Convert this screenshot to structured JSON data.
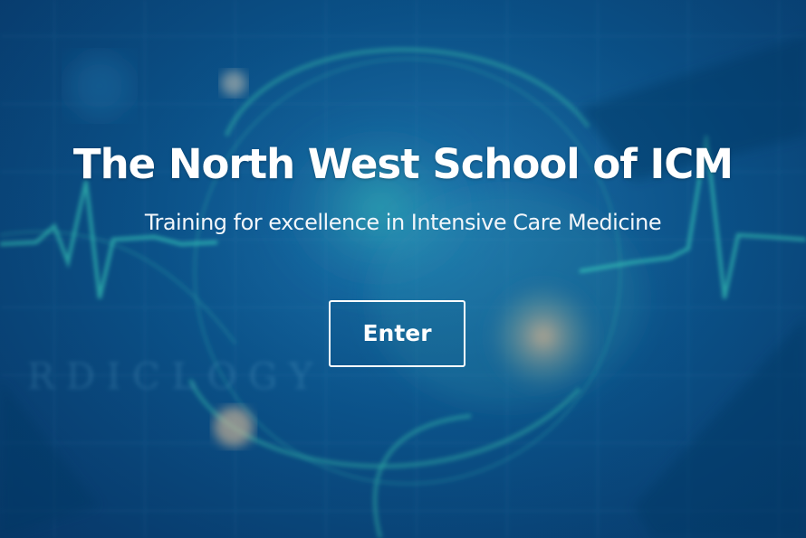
{
  "hero": {
    "title": "The North West School of ICM",
    "subtitle": "Training for excellence in Intensive Care Medicine",
    "enter_label": "Enter",
    "background_image": "blurred-medical-heart-ecg-image"
  },
  "colors": {
    "background_dark": "#083f74",
    "background_mid": "#0c5a94",
    "accent_teal": "#2ec4b6",
    "text": "#ffffff"
  }
}
